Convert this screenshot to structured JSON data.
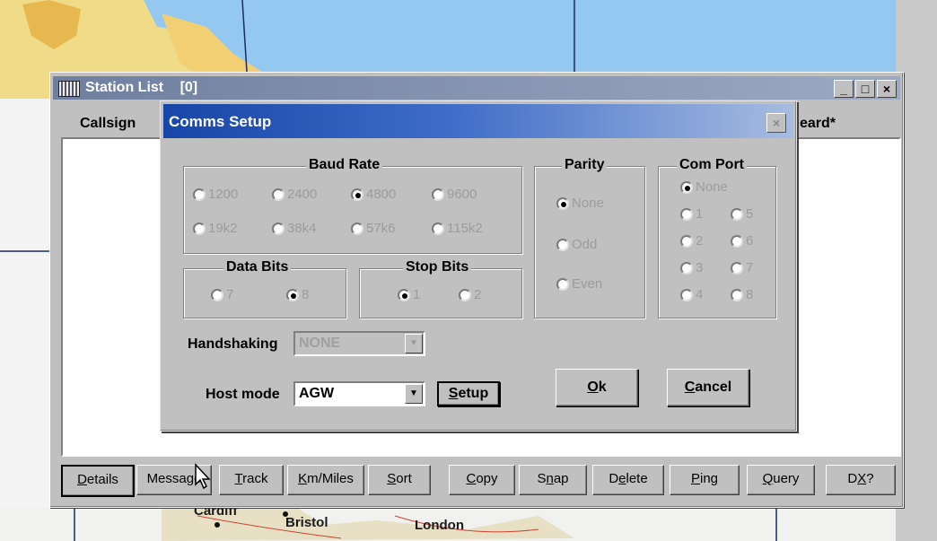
{
  "map": {
    "places": [
      "Cardiff",
      "Bristol",
      "London"
    ]
  },
  "station_list": {
    "title": "Station List",
    "count": "[0]",
    "col_callsign": "Callsign",
    "col_heard": "eard*",
    "controls": {
      "minimize": "_",
      "maximize": "□",
      "close": "×"
    },
    "buttons": [
      {
        "pre": "",
        "u": "D",
        "post": "etails"
      },
      {
        "pre": "Messa",
        "u": "g",
        "post": "e"
      },
      {
        "pre": "",
        "u": "T",
        "post": "rack"
      },
      {
        "pre": "",
        "u": "K",
        "post": "m/Miles"
      },
      {
        "pre": "",
        "u": "S",
        "post": "ort"
      },
      {
        "pre": "",
        "u": "C",
        "post": "opy"
      },
      {
        "pre": "S",
        "u": "n",
        "post": "ap"
      },
      {
        "pre": "D",
        "u": "e",
        "post": "lete"
      },
      {
        "pre": "",
        "u": "P",
        "post": "ing"
      },
      {
        "pre": "",
        "u": "Q",
        "post": "uery"
      },
      {
        "pre": "D",
        "u": "X",
        "post": "?"
      }
    ]
  },
  "dialog": {
    "title": "Comms Setup",
    "close": "×",
    "baud": {
      "label": "Baud Rate",
      "options": [
        "1200",
        "2400",
        "4800",
        "9600",
        "19k2",
        "38k4",
        "57k6",
        "115k2"
      ],
      "selected": "4800"
    },
    "parity": {
      "label": "Parity",
      "options": [
        "None",
        "Odd",
        "Even"
      ],
      "selected": "None"
    },
    "comport": {
      "label": "Com Port",
      "options": [
        "None",
        "1",
        "5",
        "2",
        "6",
        "3",
        "7",
        "4",
        "8"
      ],
      "selected": "None"
    },
    "databits": {
      "label": "Data Bits",
      "options": [
        "7",
        "8"
      ],
      "selected": "8"
    },
    "stopbits": {
      "label": "Stop Bits",
      "options": [
        "1",
        "2"
      ],
      "selected": "1"
    },
    "handshaking": {
      "label": "Handshaking",
      "value": "NONE"
    },
    "hostmode": {
      "label": "Host mode",
      "value": "AGW"
    },
    "setup_button": {
      "pre": "",
      "u": "S",
      "post": "etup"
    },
    "ok_button": {
      "pre": "",
      "u": "O",
      "post": "k"
    },
    "cancel_button": {
      "pre": "",
      "u": "C",
      "post": "ancel"
    }
  }
}
